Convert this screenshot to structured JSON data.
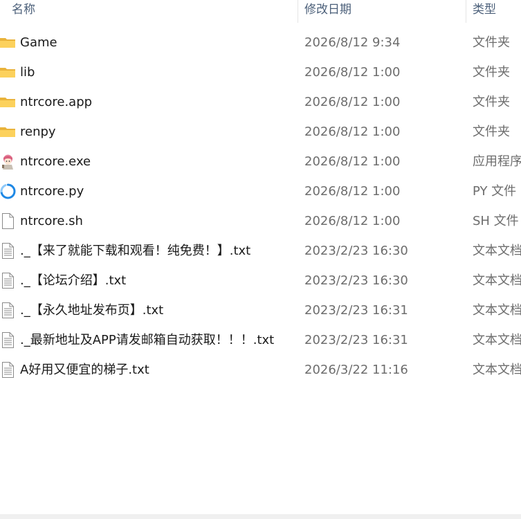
{
  "columns": {
    "name": "名称",
    "date": "修改日期",
    "type": "类型"
  },
  "files": [
    {
      "name": "Game",
      "date": "2026/8/12 9:34",
      "type": "文件夹",
      "icon": "folder-icon"
    },
    {
      "name": "lib",
      "date": "2026/8/12 1:00",
      "type": "文件夹",
      "icon": "folder-icon"
    },
    {
      "name": "ntrcore.app",
      "date": "2026/8/12 1:00",
      "type": "文件夹",
      "icon": "folder-icon"
    },
    {
      "name": "renpy",
      "date": "2026/8/12 1:00",
      "type": "文件夹",
      "icon": "folder-icon"
    },
    {
      "name": "ntrcore.exe",
      "date": "2026/8/12 1:00",
      "type": "应用程序",
      "icon": "app-character-icon"
    },
    {
      "name": "ntrcore.py",
      "date": "2026/8/12 1:00",
      "type": "PY 文件",
      "icon": "python-file-icon"
    },
    {
      "name": "ntrcore.sh",
      "date": "2026/8/12 1:00",
      "type": "SH 文件",
      "icon": "blank-file-icon"
    },
    {
      "name": "._【来了就能下载和观看！纯免费！】.txt",
      "date": "2023/2/23 16:30",
      "type": "文本文档",
      "icon": "text-file-icon"
    },
    {
      "name": "._【论坛介绍】.txt",
      "date": "2023/2/23 16:30",
      "type": "文本文档",
      "icon": "text-file-icon"
    },
    {
      "name": "._【永久地址发布页】.txt",
      "date": "2023/2/23 16:31",
      "type": "文本文档",
      "icon": "text-file-icon"
    },
    {
      "name": "._最新地址及APP请发邮箱自动获取！！！.txt",
      "date": "2023/2/23 16:31",
      "type": "文本文档",
      "icon": "text-file-icon"
    },
    {
      "name": "A好用又便宜的梯子.txt",
      "date": "2026/3/22 11:16",
      "type": "文本文档",
      "icon": "text-file-icon"
    }
  ]
}
